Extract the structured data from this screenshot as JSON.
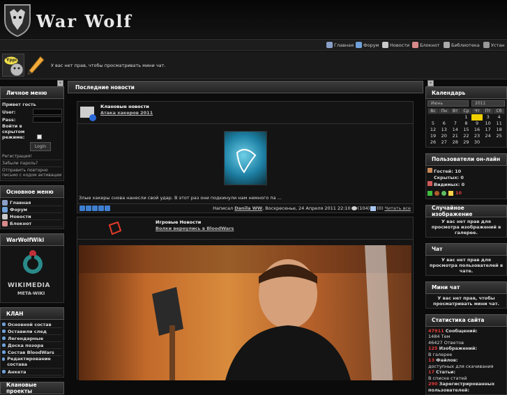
{
  "header": {
    "title": "War Wolf"
  },
  "nav": {
    "items": [
      {
        "label": "Главная"
      },
      {
        "label": "Форум"
      },
      {
        "label": "Новости"
      },
      {
        "label": "Блокнот"
      },
      {
        "label": "Библиотека"
      },
      {
        "label": "Устан"
      }
    ]
  },
  "chat": {
    "badge": "Yppi",
    "message": "У вас нет прав, чтобы просматривать мини чат."
  },
  "left": {
    "personal_title": "Личное меню",
    "greeting": "Привет гость",
    "user_label": "User:",
    "pass_label": "Pass:",
    "hidden_mode": "Войти в скрытом режиме:",
    "login_button": "Login",
    "register": "Регистрация!",
    "forgot": "Забыли пароль?",
    "resend": "Отправить повторно письмо с кодом активации",
    "main_menu_title": "Основное меню",
    "main_menu": [
      "Главная",
      "Форум",
      "Новости",
      "Блокнот"
    ],
    "wiki_title": "WarWolfWiki",
    "wiki_caption1": "WIKIMEDIA",
    "wiki_caption2": "META-WIKI",
    "clan_title": "КЛАН",
    "clan_menu": [
      "Основной состав",
      "Оставили след",
      "Легендарные",
      "Доска позора",
      "Состав BloodWars",
      "Редактирование состава",
      "Анкета"
    ],
    "projects_title": "Клановые проекты"
  },
  "main": {
    "title": "Последние новости",
    "news1": {
      "category": "Клановые новости",
      "title": "Атака хакеров 2011",
      "text": "Злые хакеры снова нанесли свой удар. В этот раз они подкинули нам немного па ...",
      "meta_prefix": "Написал",
      "author": "Danila WW",
      "date": ", Воскресенье, 24 Апреля 2011 22:10",
      "views": "(104)",
      "comments": "(0)",
      "read_all": "Читать все"
    },
    "news2": {
      "category": "Игровые Новости",
      "title": "Волки вернулись в BloodWars"
    }
  },
  "right": {
    "calendar_title": "Календарь",
    "month": "Июнь",
    "year": "2011",
    "weekdays": [
      "Вс",
      "Пн",
      "Вт",
      "Ср",
      "Чт",
      "Пт",
      "Сб"
    ],
    "rows": [
      [
        "",
        "",
        "",
        "1",
        "2",
        "3",
        "4"
      ],
      [
        "5",
        "6",
        "7",
        "8",
        "9",
        "10",
        "11"
      ],
      [
        "12",
        "13",
        "14",
        "15",
        "16",
        "17",
        "18"
      ],
      [
        "19",
        "20",
        "21",
        "22",
        "23",
        "24",
        "25"
      ],
      [
        "26",
        "27",
        "28",
        "29",
        "30",
        "",
        ""
      ]
    ],
    "online_title": "Пользователи он-лайн",
    "guests_label": "Гостей:",
    "guests": "10",
    "hidden_label": "Скрытых:",
    "hidden": "0",
    "visible_label": "Видимых:",
    "visible": "0",
    "online_count": "10",
    "gallery_title": "Случайное изображение",
    "gallery_text": "У вас нет прав для просмотра изображений в галерее.",
    "chat_title": "Чат",
    "chat_text": "У вас нет прав для просмотра пользователей в чате.",
    "minichat_title": "Мини чат",
    "minichat_text": "У вас нет прав, чтобы просматривать мини чат.",
    "stats_title": "Статистика сайта",
    "stats": [
      {
        "n": "47911",
        "l": "Сообщений:"
      },
      {
        "t": "1484 Тем"
      },
      {
        "t": "46427 Ответов"
      },
      {
        "n": "125",
        "l": "Изображений:"
      },
      {
        "t": "В галерее"
      },
      {
        "n": "13",
        "l": "Файлов:"
      },
      {
        "t": "доступных для скачивания"
      },
      {
        "n": "17",
        "l": "Статьи:"
      },
      {
        "t": "В списке статей"
      },
      {
        "n": "290",
        "l": "Зарегистрированных пользователей:"
      }
    ]
  },
  "colors": {
    "accent_red": "#e63a3a",
    "today_bg": "#f0d000",
    "bg": "#0b0b0b"
  }
}
